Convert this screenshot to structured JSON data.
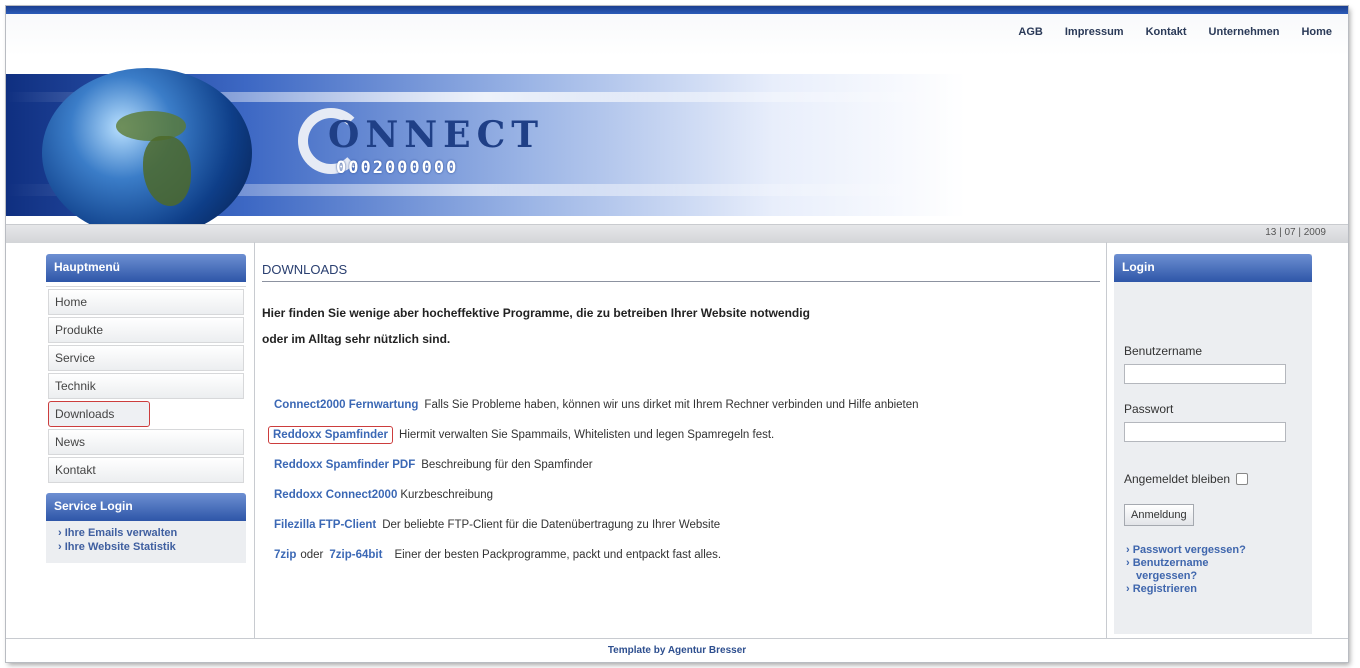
{
  "topnav": [
    "AGB",
    "Impressum",
    "Kontakt",
    "Unternehmen",
    "Home"
  ],
  "logo": {
    "word": "ONNECT",
    "number": "0002000000"
  },
  "date": "13 | 07 | 2009",
  "left": {
    "menu_title": "Hauptmenü",
    "menu": [
      "Home",
      "Produkte",
      "Service",
      "Technik",
      "Downloads",
      "News",
      "Kontakt"
    ],
    "service_title": "Service Login",
    "service_links": [
      "› Ihre Emails verwalten",
      "› Ihre Website Statistik"
    ]
  },
  "main": {
    "title": "DOWNLOADS",
    "intro_line1": "Hier finden Sie wenige aber hocheffektive Programme, die zu betreiben Ihrer Website notwendig",
    "intro_line2": "oder im Alltag  sehr nützlich sind.",
    "items": [
      {
        "link": "Connect2000 Fernwartung",
        "desc": "Falls Sie Probleme haben, können wir uns dirket mit Ihrem Rechner verbinden und Hilfe anbieten"
      },
      {
        "link": "Reddoxx Spamfinder",
        "desc": "Hiermit verwalten Sie Spammails,  Whitelisten und legen Spamregeln fest."
      },
      {
        "link": "Reddoxx Spamfinder PDF",
        "desc": "Beschreibung für den Spamfinder"
      },
      {
        "link": "Reddoxx Connect2000",
        "desc": "Kurzbeschreibung"
      },
      {
        "link": "Filezilla FTP-Client",
        "desc": "Der beliebte FTP-Client für die Datenübertragung zu Ihrer Website"
      },
      {
        "link": "7zip",
        "mid": "oder",
        "link2": "7zip-64bit",
        "desc": "Einer der besten Packprogramme, packt und entpackt fast alles."
      }
    ]
  },
  "login": {
    "title": "Login",
    "username_label": "Benutzername",
    "password_label": "Passwort",
    "remember_label": "Angemeldet bleiben",
    "button": "Anmeldung",
    "links": [
      "› Passwort vergessen?",
      "› Benutzername",
      "vergessen?",
      "› Registrieren"
    ]
  },
  "footer": "Template by Agentur Bresser"
}
